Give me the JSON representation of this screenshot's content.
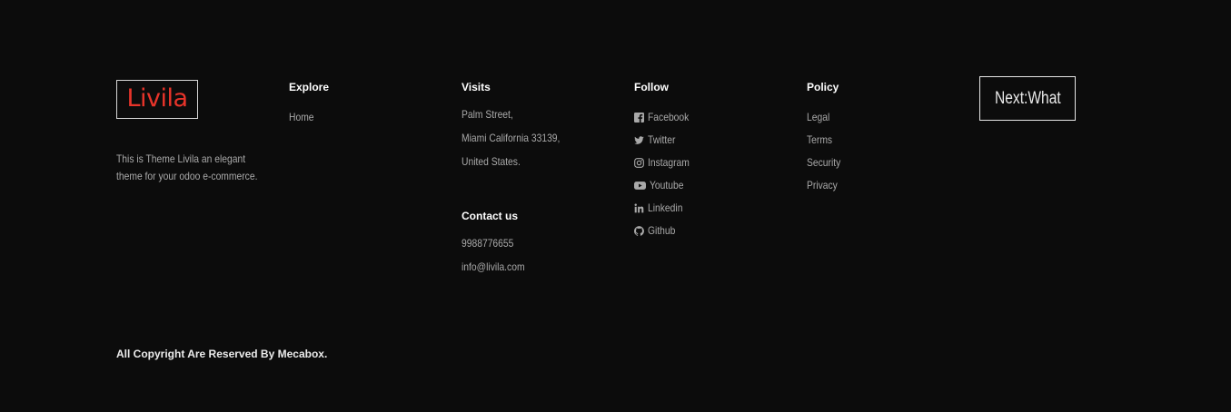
{
  "brand": {
    "logo_text": "Livila",
    "logo_color": "#e8342a",
    "description": "This is Theme Livila an elegant theme for your odoo e-commerce."
  },
  "explore": {
    "title": "Explore",
    "items": [
      {
        "label": "Home"
      }
    ]
  },
  "visits": {
    "title": "Visits",
    "address": [
      "Palm Street,",
      "Miami California 33139,",
      "United States."
    ]
  },
  "contact": {
    "title": "Contact us",
    "phone": "9988776655",
    "email": "info@livila.com"
  },
  "follow": {
    "title": "Follow",
    "items": [
      {
        "label": "Facebook",
        "icon": "facebook-icon"
      },
      {
        "label": "Twitter",
        "icon": "twitter-icon"
      },
      {
        "label": "Instagram",
        "icon": "instagram-icon"
      },
      {
        "label": "Youtube",
        "icon": "youtube-icon"
      },
      {
        "label": "Linkedin",
        "icon": "linkedin-icon"
      },
      {
        "label": "Github",
        "icon": "github-icon"
      }
    ]
  },
  "policy": {
    "title": "Policy",
    "items": [
      {
        "label": "Legal"
      },
      {
        "label": "Terms"
      },
      {
        "label": "Security"
      },
      {
        "label": "Privacy"
      }
    ]
  },
  "next_button": {
    "label": "Next:What"
  },
  "copyright": "All Copyright Are Reserved By Mecabox.",
  "colors": {
    "background": "#0c0c0c",
    "muted_text": "#a9a9a9",
    "heading": "#ffffff"
  }
}
